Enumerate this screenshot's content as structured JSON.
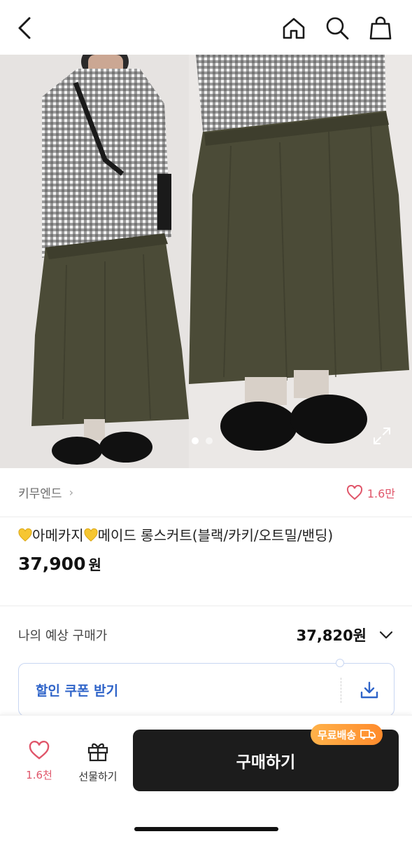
{
  "header": {
    "back_icon": "chevron-left-icon",
    "home_icon": "home-icon",
    "search_icon": "search-icon",
    "bag_icon": "shopping-bag-icon"
  },
  "gallery": {
    "total_images": 2,
    "active_index": 1,
    "expand_icon": "expand-icon"
  },
  "shop": {
    "name": "키무엔드",
    "likes": "1.6만"
  },
  "product": {
    "title_part1": "아메카지",
    "title_part2": "메이드 롱스커트(블랙/카키/오트밀/밴딩)",
    "price": "37,900",
    "currency": "원",
    "emoji": "yellow-heart"
  },
  "estimate": {
    "label": "나의 예상 구매가",
    "value": "37,820원"
  },
  "coupon": {
    "label": "할인 쿠폰 받기",
    "icon": "download-icon"
  },
  "bottom_bar": {
    "like_count": "1.6천",
    "gift_label": "선물하기",
    "buy_label": "구매하기",
    "badge": "무료배송"
  },
  "colors": {
    "accent_pink": "#e0566a",
    "coupon_blue": "#2f64c9",
    "buy_button": "#1c1c1c",
    "badge_orange": "#ff9a35"
  }
}
